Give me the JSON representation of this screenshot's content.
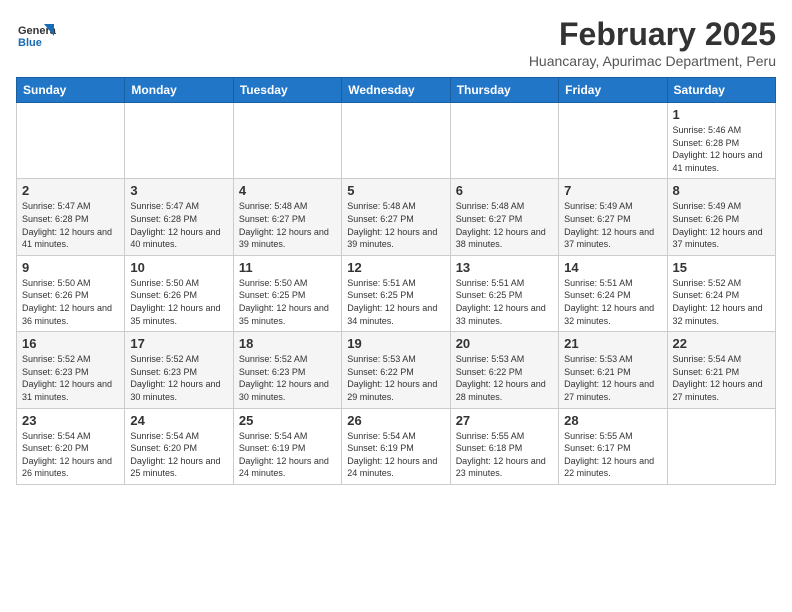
{
  "header": {
    "logo": {
      "line1": "General",
      "line2": "Blue"
    },
    "month": "February 2025",
    "location": "Huancaray, Apurimac Department, Peru"
  },
  "days_of_week": [
    "Sunday",
    "Monday",
    "Tuesday",
    "Wednesday",
    "Thursday",
    "Friday",
    "Saturday"
  ],
  "weeks": [
    [
      {
        "day": "",
        "info": ""
      },
      {
        "day": "",
        "info": ""
      },
      {
        "day": "",
        "info": ""
      },
      {
        "day": "",
        "info": ""
      },
      {
        "day": "",
        "info": ""
      },
      {
        "day": "",
        "info": ""
      },
      {
        "day": "1",
        "info": "Sunrise: 5:46 AM\nSunset: 6:28 PM\nDaylight: 12 hours and 41 minutes."
      }
    ],
    [
      {
        "day": "2",
        "info": "Sunrise: 5:47 AM\nSunset: 6:28 PM\nDaylight: 12 hours and 41 minutes."
      },
      {
        "day": "3",
        "info": "Sunrise: 5:47 AM\nSunset: 6:28 PM\nDaylight: 12 hours and 40 minutes."
      },
      {
        "day": "4",
        "info": "Sunrise: 5:48 AM\nSunset: 6:27 PM\nDaylight: 12 hours and 39 minutes."
      },
      {
        "day": "5",
        "info": "Sunrise: 5:48 AM\nSunset: 6:27 PM\nDaylight: 12 hours and 39 minutes."
      },
      {
        "day": "6",
        "info": "Sunrise: 5:48 AM\nSunset: 6:27 PM\nDaylight: 12 hours and 38 minutes."
      },
      {
        "day": "7",
        "info": "Sunrise: 5:49 AM\nSunset: 6:27 PM\nDaylight: 12 hours and 37 minutes."
      },
      {
        "day": "8",
        "info": "Sunrise: 5:49 AM\nSunset: 6:26 PM\nDaylight: 12 hours and 37 minutes."
      }
    ],
    [
      {
        "day": "9",
        "info": "Sunrise: 5:50 AM\nSunset: 6:26 PM\nDaylight: 12 hours and 36 minutes."
      },
      {
        "day": "10",
        "info": "Sunrise: 5:50 AM\nSunset: 6:26 PM\nDaylight: 12 hours and 35 minutes."
      },
      {
        "day": "11",
        "info": "Sunrise: 5:50 AM\nSunset: 6:25 PM\nDaylight: 12 hours and 35 minutes."
      },
      {
        "day": "12",
        "info": "Sunrise: 5:51 AM\nSunset: 6:25 PM\nDaylight: 12 hours and 34 minutes."
      },
      {
        "day": "13",
        "info": "Sunrise: 5:51 AM\nSunset: 6:25 PM\nDaylight: 12 hours and 33 minutes."
      },
      {
        "day": "14",
        "info": "Sunrise: 5:51 AM\nSunset: 6:24 PM\nDaylight: 12 hours and 32 minutes."
      },
      {
        "day": "15",
        "info": "Sunrise: 5:52 AM\nSunset: 6:24 PM\nDaylight: 12 hours and 32 minutes."
      }
    ],
    [
      {
        "day": "16",
        "info": "Sunrise: 5:52 AM\nSunset: 6:23 PM\nDaylight: 12 hours and 31 minutes."
      },
      {
        "day": "17",
        "info": "Sunrise: 5:52 AM\nSunset: 6:23 PM\nDaylight: 12 hours and 30 minutes."
      },
      {
        "day": "18",
        "info": "Sunrise: 5:52 AM\nSunset: 6:23 PM\nDaylight: 12 hours and 30 minutes."
      },
      {
        "day": "19",
        "info": "Sunrise: 5:53 AM\nSunset: 6:22 PM\nDaylight: 12 hours and 29 minutes."
      },
      {
        "day": "20",
        "info": "Sunrise: 5:53 AM\nSunset: 6:22 PM\nDaylight: 12 hours and 28 minutes."
      },
      {
        "day": "21",
        "info": "Sunrise: 5:53 AM\nSunset: 6:21 PM\nDaylight: 12 hours and 27 minutes."
      },
      {
        "day": "22",
        "info": "Sunrise: 5:54 AM\nSunset: 6:21 PM\nDaylight: 12 hours and 27 minutes."
      }
    ],
    [
      {
        "day": "23",
        "info": "Sunrise: 5:54 AM\nSunset: 6:20 PM\nDaylight: 12 hours and 26 minutes."
      },
      {
        "day": "24",
        "info": "Sunrise: 5:54 AM\nSunset: 6:20 PM\nDaylight: 12 hours and 25 minutes."
      },
      {
        "day": "25",
        "info": "Sunrise: 5:54 AM\nSunset: 6:19 PM\nDaylight: 12 hours and 24 minutes."
      },
      {
        "day": "26",
        "info": "Sunrise: 5:54 AM\nSunset: 6:19 PM\nDaylight: 12 hours and 24 minutes."
      },
      {
        "day": "27",
        "info": "Sunrise: 5:55 AM\nSunset: 6:18 PM\nDaylight: 12 hours and 23 minutes."
      },
      {
        "day": "28",
        "info": "Sunrise: 5:55 AM\nSunset: 6:17 PM\nDaylight: 12 hours and 22 minutes."
      },
      {
        "day": "",
        "info": ""
      }
    ]
  ]
}
